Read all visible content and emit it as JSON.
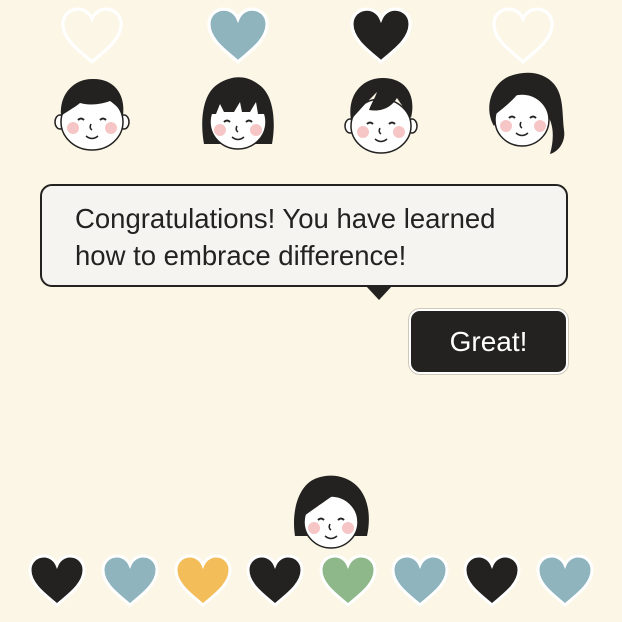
{
  "colors": {
    "background": "#fbf6e6",
    "dark": "#232220",
    "blue": "#8fb4bd",
    "yellow": "#f3bd5a",
    "green": "#8eb88a",
    "outline_white": "#ffffff"
  },
  "top_hearts": [
    {
      "state": "empty-outline",
      "color": "#ffffff"
    },
    {
      "state": "filled",
      "color": "#8fb4bd"
    },
    {
      "state": "filled",
      "color": "#232220"
    },
    {
      "state": "empty-outline",
      "color": "#ffffff"
    }
  ],
  "characters": [
    {
      "icon": "boy-short-hair-face-icon"
    },
    {
      "icon": "girl-bob-bangs-face-icon"
    },
    {
      "icon": "boy-side-part-face-icon"
    },
    {
      "icon": "woman-curly-hair-face-icon"
    }
  ],
  "dialog": {
    "message": "Congratulations! You have learned how to embrace difference!"
  },
  "great_button": {
    "label": "Great!"
  },
  "player": {
    "icon": "player-girl-face-icon"
  },
  "heart_inventory": [
    {
      "color": "#232220"
    },
    {
      "color": "#8fb4bd"
    },
    {
      "color": "#f3bd5a"
    },
    {
      "color": "#232220"
    },
    {
      "color": "#8eb88a"
    },
    {
      "color": "#8fb4bd"
    },
    {
      "color": "#232220"
    },
    {
      "color": "#8fb4bd"
    }
  ]
}
